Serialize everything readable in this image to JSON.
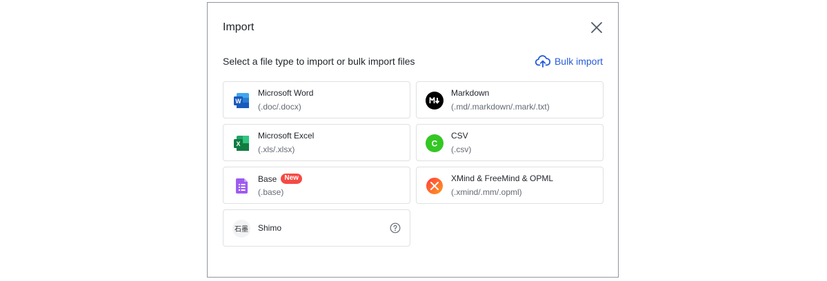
{
  "dialog": {
    "title": "Import",
    "subtitle": "Select a file type to import or bulk import files",
    "bulk_import_label": "Bulk import",
    "accent_color": "#245bdb"
  },
  "file_types": [
    {
      "name": "Microsoft Word",
      "ext": "(.doc/.docx)",
      "icon": "word-icon"
    },
    {
      "name": "Markdown",
      "ext": "(.md/.markdown/.mark/.txt)",
      "icon": "markdown-icon"
    },
    {
      "name": "Microsoft Excel",
      "ext": "(.xls/.xlsx)",
      "icon": "excel-icon"
    },
    {
      "name": "CSV",
      "ext": "(.csv)",
      "icon": "csv-icon"
    },
    {
      "name": "Base",
      "badge": "New",
      "ext": "(.base)",
      "icon": "base-icon"
    },
    {
      "name": "XMind & FreeMind & OPML",
      "ext": "(.xmind/.mm/.opml)",
      "icon": "xmind-icon"
    },
    {
      "name": "Shimo",
      "icon": "shimo-icon",
      "shimo_glyphs": "石墨"
    }
  ]
}
